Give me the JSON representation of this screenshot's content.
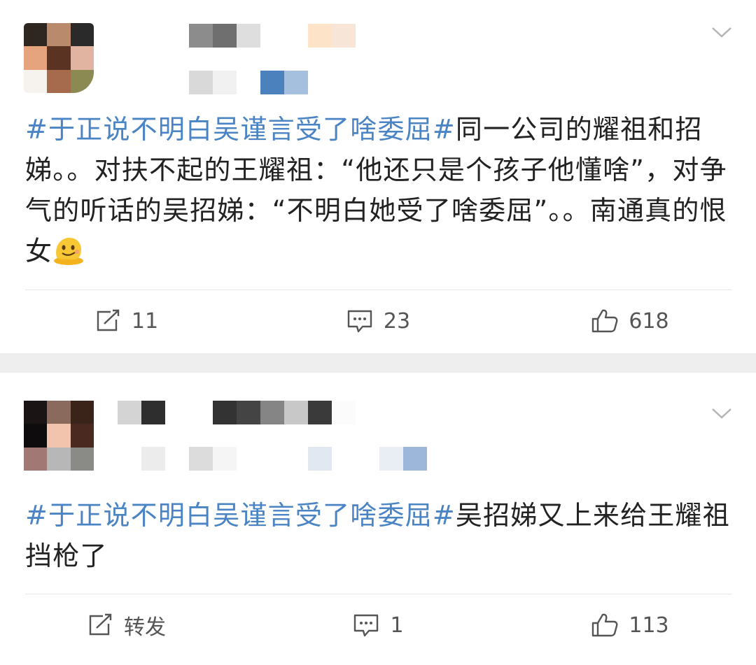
{
  "posts": [
    {
      "text_tag": "#于正说不明白吴谨言受了啥委屈#",
      "text_body": "同一公司的耀祖和招娣。。对扶不起的王耀祖：“他还只是个孩子他懂啥”，对争气的听话的吴招娣：“不明白她受了啥委屈”。。南通真的恨女",
      "emoji": "melting-face-emoji",
      "repost": "11",
      "comments": "23",
      "likes": "618"
    },
    {
      "text_tag": "#于正说不明白吴谨言受了啥委屈#",
      "text_body": "吴招娣又上来给王耀祖挡枪了",
      "repost": "转发",
      "comments": "1",
      "likes": "113"
    }
  ],
  "colors": {
    "hashtag": "#4a84c4",
    "separator": "#eeeeee",
    "action_text": "#555555"
  },
  "icons": {
    "menu": "chevron-down-icon",
    "repost": "repost-icon",
    "comment": "comment-icon",
    "like": "thumbs-up-icon"
  }
}
